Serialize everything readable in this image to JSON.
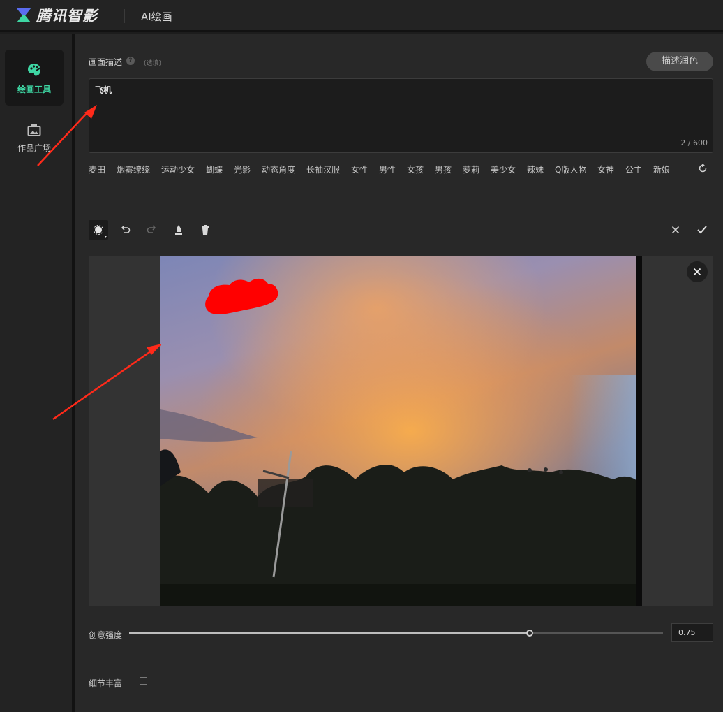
{
  "header": {
    "brand": "腾讯智影",
    "app_title": "AI绘画"
  },
  "sidebar": {
    "items": [
      {
        "label": "绘画工具",
        "icon": "palette-icon",
        "active": true
      },
      {
        "label": "作品广场",
        "icon": "gallery-icon",
        "active": false
      }
    ]
  },
  "prompt": {
    "label": "画面描述",
    "optional_hint": "(选填)",
    "polish_button": "描述润色",
    "value": "飞机",
    "char_count": "2 / 600"
  },
  "tags": [
    "麦田",
    "烟雾缭绕",
    "运动少女",
    "蝴蝶",
    "光影",
    "动态角度",
    "长袖汉服",
    "女性",
    "男性",
    "女孩",
    "男孩",
    "萝莉",
    "美少女",
    "辣妹",
    "Q版人物",
    "女神",
    "公主",
    "新娘"
  ],
  "toolbar": {
    "tools": [
      "brush-icon",
      "undo-icon",
      "redo-icon",
      "eraser-icon",
      "trash-icon"
    ],
    "cancel_icon": "close-icon",
    "confirm_icon": "check-icon"
  },
  "creativity": {
    "label": "创意强度",
    "value": "0.75",
    "level": 0.75
  },
  "detail": {
    "label": "细节丰富",
    "checked": false
  },
  "colors": {
    "accent": "#3ed6a3",
    "annotation": "#ff2a1a"
  }
}
